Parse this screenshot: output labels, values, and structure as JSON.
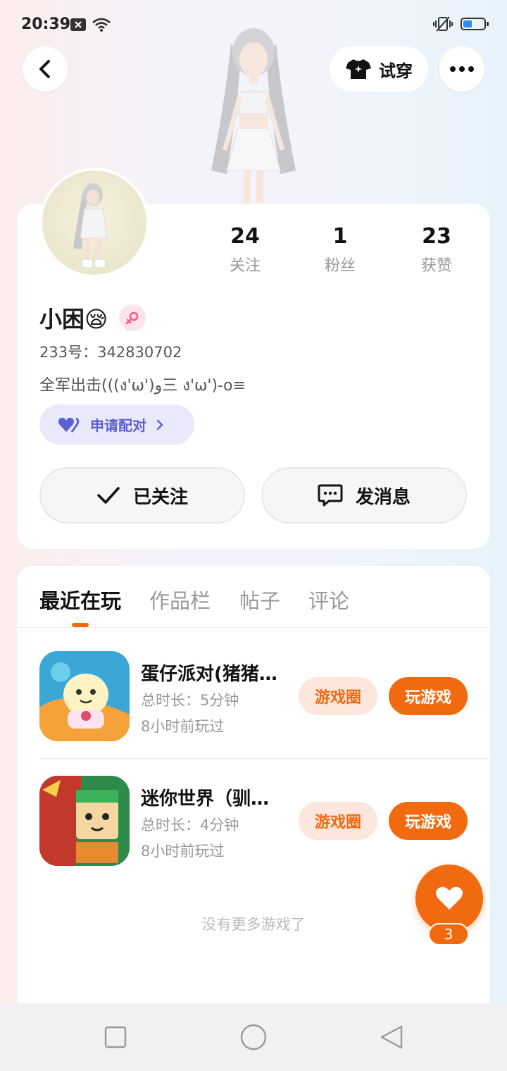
{
  "status_bar": {
    "time": "20:39"
  },
  "header": {
    "tryon_label": "试穿"
  },
  "profile": {
    "stats": [
      {
        "value": "24",
        "label": "关注"
      },
      {
        "value": "1",
        "label": "粉丝"
      },
      {
        "value": "23",
        "label": "获赞"
      }
    ],
    "nickname": "小困😪",
    "uid": "233号：342830702",
    "bio": "全军出击(((ง'ω')و三 ง'ω')-o≡",
    "pair_label": "申请配对",
    "followed_label": "已关注",
    "message_label": "发消息"
  },
  "tabs": [
    {
      "label": "最近在玩"
    },
    {
      "label": "作品栏"
    },
    {
      "label": "帖子"
    },
    {
      "label": "评论"
    }
  ],
  "games": [
    {
      "title": "蛋仔派对(猪猪…",
      "duration": "总时长：5分钟",
      "last_played": "8小时前玩过",
      "circle_label": "游戏圈",
      "play_label": "玩游戏"
    },
    {
      "title": "迷你世界（驯…",
      "duration": "总时长：4分钟",
      "last_played": "8小时前玩过",
      "circle_label": "游戏圈",
      "play_label": "玩游戏"
    }
  ],
  "no_more_text": "没有更多游戏了",
  "like_count": "3",
  "colors": {
    "accent": "#f26a10",
    "pair": "#5d5fd6"
  }
}
